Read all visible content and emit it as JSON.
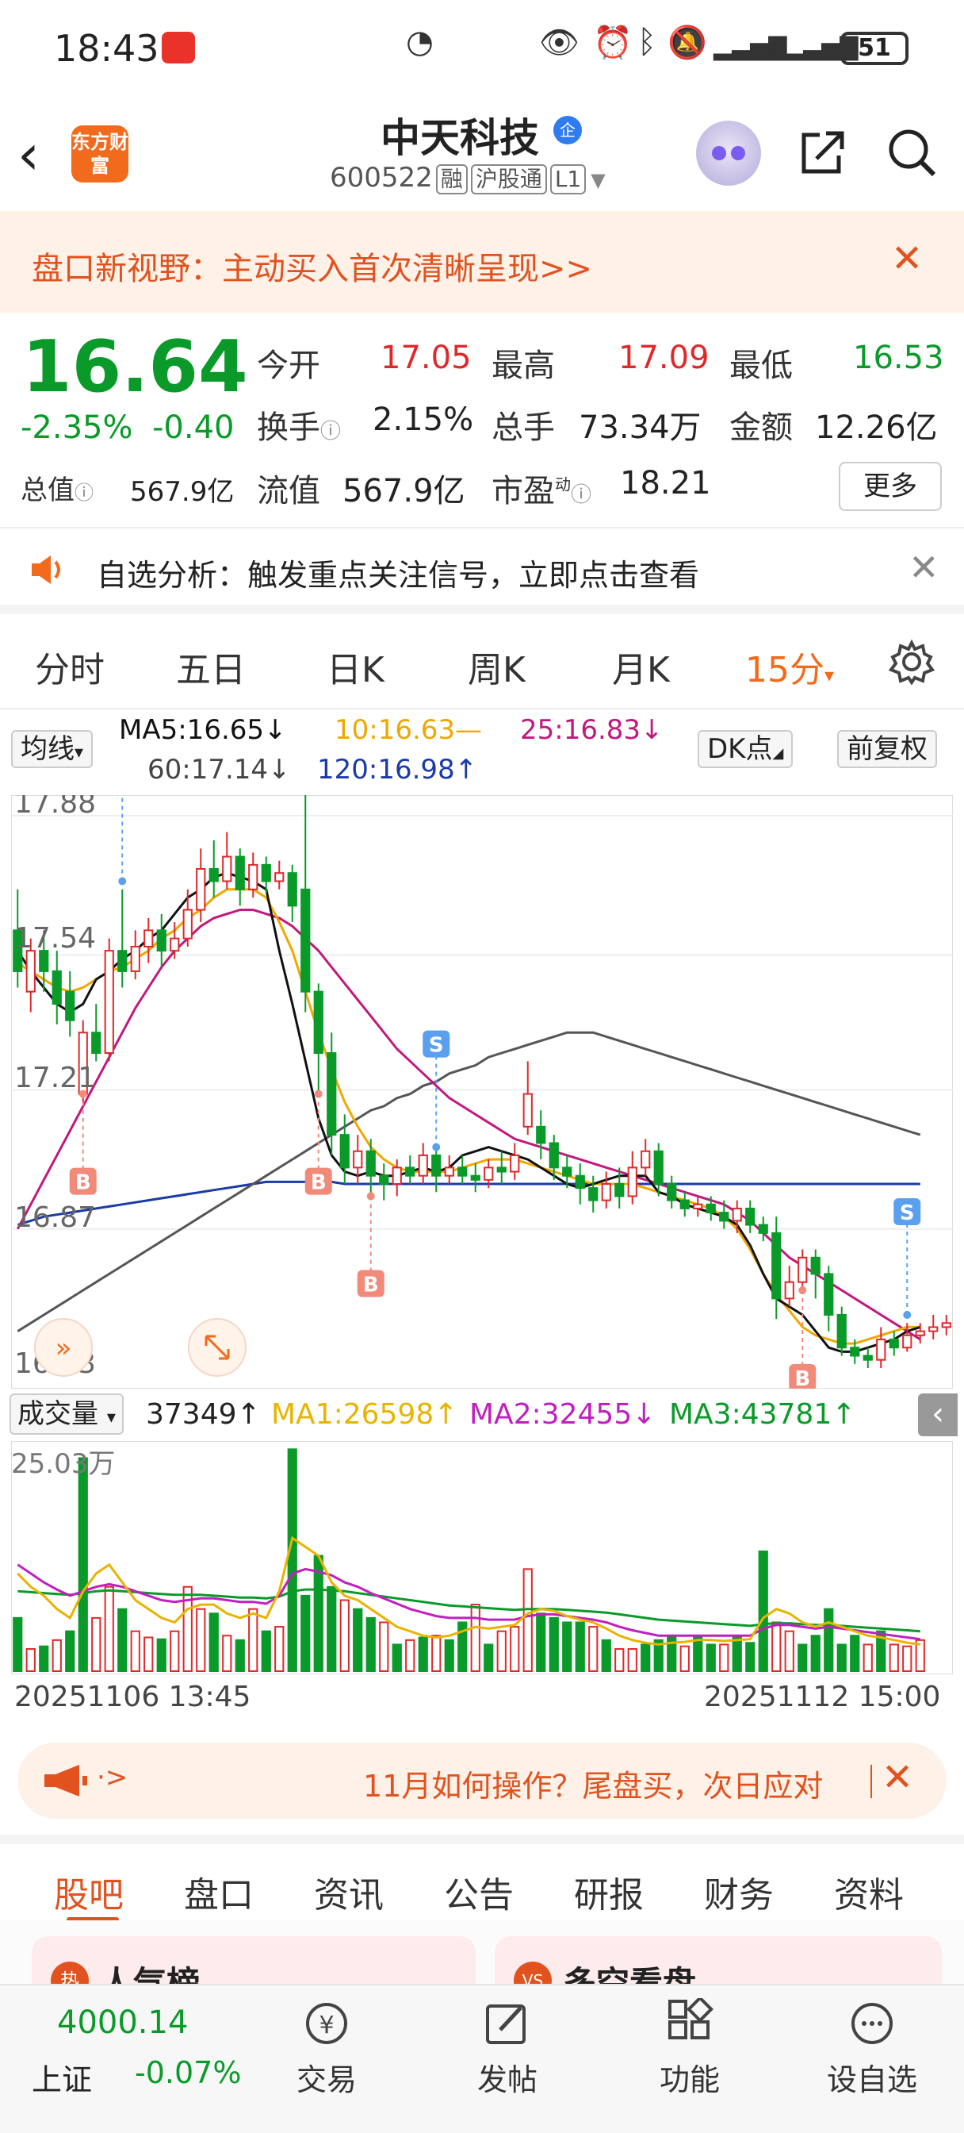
{
  "status_bar": {
    "time": "18:43",
    "battery": "51"
  },
  "header": {
    "logo": "东方财富",
    "title": "中天科技",
    "badge": "企",
    "code": "600522",
    "tags": [
      "融",
      "沪股通",
      "L1"
    ]
  },
  "banner": {
    "text": "盘口新视野：主动买入首次清晰呈现>>"
  },
  "quote": {
    "price": "16.64",
    "change_pct": "-2.35%",
    "change": "-0.40",
    "open_label": "今开",
    "open": "17.05",
    "high_label": "最高",
    "high": "17.09",
    "low_label": "最低",
    "low": "16.53",
    "turnover_label": "换手",
    "turnover": "2.15%",
    "volume_label": "总手",
    "volume": "73.34万",
    "amount_label": "金额",
    "amount": "12.26亿",
    "mktcap_label": "总值",
    "mktcap": "567.9亿",
    "float_label": "流值",
    "float": "567.9亿",
    "pe_label": "市盈",
    "pe_sup": "动",
    "pe": "18.21",
    "more": "更多"
  },
  "alert": {
    "text": "自选分析：触发重点关注信号，立即点击查看"
  },
  "chart_tabs": [
    "分时",
    "五日",
    "日K",
    "周K",
    "月K",
    "15分"
  ],
  "indicators": {
    "ma_selector": "均线",
    "ma5": "MA5:16.65↓",
    "ma10": "10:16.63—",
    "ma25": "25:16.83↓",
    "ma60": "60:17.14↓",
    "ma120": "120:16.98↑",
    "dk": "DK点",
    "adjust": "前复权"
  },
  "colors": {
    "up": "#e0282a",
    "down": "#0a9a2a",
    "accent": "#f26a1b",
    "ma5": "#111111",
    "ma10": "#f0a800",
    "ma25": "#c2187d",
    "ma60": "#555555",
    "ma120": "#1a3aa8",
    "vma1": "#e8b400",
    "vma2": "#c020c0",
    "vma3": "#0a9a2a"
  },
  "chart_data": {
    "type": "candlestick",
    "y_ticks": [
      "17.88",
      "17.54",
      "17.21",
      "16.87",
      "16.53"
    ],
    "ylim": [
      16.53,
      17.88
    ],
    "candles": [
      [
        17.6,
        17.5,
        17.7,
        17.46
      ],
      [
        17.45,
        17.55,
        17.58,
        17.4
      ],
      [
        17.55,
        17.5,
        17.6,
        17.45
      ],
      [
        17.5,
        17.42,
        17.55,
        17.37
      ],
      [
        17.45,
        17.38,
        17.5,
        17.34
      ],
      [
        17.2,
        17.35,
        17.38,
        17.18
      ],
      [
        17.35,
        17.3,
        17.42,
        17.28
      ],
      [
        17.3,
        17.55,
        17.58,
        17.28
      ],
      [
        17.55,
        17.5,
        17.7,
        17.46
      ],
      [
        17.5,
        17.56,
        17.6,
        17.48
      ],
      [
        17.56,
        17.6,
        17.63,
        17.52
      ],
      [
        17.6,
        17.55,
        17.64,
        17.51
      ],
      [
        17.55,
        17.58,
        17.62,
        17.53
      ],
      [
        17.58,
        17.65,
        17.7,
        17.56
      ],
      [
        17.65,
        17.75,
        17.8,
        17.62
      ],
      [
        17.75,
        17.72,
        17.82,
        17.68
      ],
      [
        17.72,
        17.78,
        17.84,
        17.7
      ],
      [
        17.78,
        17.7,
        17.8,
        17.66
      ],
      [
        17.7,
        17.76,
        17.79,
        17.68
      ],
      [
        17.76,
        17.72,
        17.78,
        17.69
      ],
      [
        17.72,
        17.74,
        17.77,
        17.7
      ],
      [
        17.74,
        17.66,
        17.76,
        17.62
      ],
      [
        17.7,
        17.45,
        18.05,
        17.4
      ],
      [
        17.45,
        17.3,
        17.47,
        17.2
      ],
      [
        17.3,
        17.1,
        17.35,
        17.05
      ],
      [
        17.1,
        17.02,
        17.15,
        16.98
      ],
      [
        17.02,
        17.06,
        17.1,
        16.98
      ],
      [
        17.06,
        17.0,
        17.09,
        16.95
      ],
      [
        17.0,
        16.98,
        17.03,
        16.94
      ],
      [
        16.98,
        17.02,
        17.04,
        16.95
      ],
      [
        17.02,
        17.0,
        17.05,
        16.98
      ],
      [
        17.0,
        17.05,
        17.08,
        16.98
      ],
      [
        17.05,
        17.0,
        17.07,
        16.96
      ],
      [
        17.0,
        17.02,
        17.05,
        16.98
      ],
      [
        17.02,
        17.0,
        17.05,
        16.98
      ],
      [
        17.0,
        16.99,
        17.03,
        16.96
      ],
      [
        16.99,
        17.02,
        17.04,
        16.97
      ],
      [
        17.02,
        17.01,
        17.06,
        16.98
      ],
      [
        17.01,
        17.05,
        17.08,
        16.99
      ],
      [
        17.12,
        17.2,
        17.28,
        17.1
      ],
      [
        17.12,
        17.08,
        17.16,
        17.04
      ],
      [
        17.08,
        17.02,
        17.1,
        16.99
      ],
      [
        17.02,
        17.0,
        17.05,
        16.97
      ],
      [
        17.0,
        16.97,
        17.03,
        16.93
      ],
      [
        16.97,
        16.94,
        17.0,
        16.91
      ],
      [
        16.94,
        16.98,
        17.01,
        16.92
      ],
      [
        16.98,
        16.95,
        17.02,
        16.92
      ],
      [
        16.95,
        17.02,
        17.06,
        16.93
      ],
      [
        17.02,
        17.06,
        17.09,
        17.0
      ],
      [
        17.06,
        16.98,
        17.08,
        16.95
      ],
      [
        16.98,
        16.94,
        17.0,
        16.92
      ],
      [
        16.94,
        16.92,
        16.96,
        16.9
      ],
      [
        16.92,
        16.93,
        16.95,
        16.9
      ],
      [
        16.93,
        16.91,
        16.95,
        16.89
      ],
      [
        16.91,
        16.89,
        16.94,
        16.87
      ],
      [
        16.89,
        16.92,
        16.94,
        16.86
      ],
      [
        16.92,
        16.88,
        16.94,
        16.86
      ],
      [
        16.88,
        16.86,
        16.9,
        16.84
      ],
      [
        16.86,
        16.7,
        16.9,
        16.65
      ],
      [
        16.7,
        16.74,
        16.78,
        16.68
      ],
      [
        16.74,
        16.8,
        16.82,
        16.72
      ],
      [
        16.8,
        16.76,
        16.82,
        16.7
      ],
      [
        16.76,
        16.66,
        16.78,
        16.62
      ],
      [
        16.66,
        16.58,
        16.68,
        16.56
      ],
      [
        16.58,
        16.56,
        16.6,
        16.54
      ],
      [
        16.56,
        16.55,
        16.58,
        16.53
      ],
      [
        16.55,
        16.6,
        16.63,
        16.53
      ],
      [
        16.6,
        16.58,
        16.62,
        16.56
      ],
      [
        16.58,
        16.61,
        16.64,
        16.57
      ],
      [
        16.61,
        16.62,
        16.64,
        16.59
      ],
      [
        16.62,
        16.63,
        16.66,
        16.6
      ],
      [
        16.63,
        16.64,
        16.66,
        16.61
      ]
    ],
    "ma5": [
      17.55,
      17.5,
      17.46,
      17.42,
      17.4,
      17.42,
      17.48,
      17.5,
      17.53,
      17.55,
      17.58,
      17.6,
      17.64,
      17.68,
      17.7,
      17.73,
      17.74,
      17.73,
      17.72,
      17.7,
      17.55,
      17.42,
      17.28,
      17.14,
      17.05,
      17.01,
      17.0,
      17.01,
      17.0,
      17.0,
      17.01,
      17.02,
      17.01,
      17.02,
      17.05,
      17.06,
      17.07,
      17.06,
      17.05,
      17.04,
      17.02,
      17.0,
      16.98,
      16.97,
      16.98,
      16.99,
      17.0,
      17.0,
      17.0,
      16.96,
      16.95,
      16.93,
      16.92,
      16.91,
      16.9,
      16.88,
      16.83,
      16.76,
      16.7,
      16.68,
      16.66,
      16.62,
      16.58,
      16.57,
      16.57,
      16.58,
      16.59,
      16.6,
      16.62,
      16.63
    ],
    "ma10": [
      17.52,
      17.5,
      17.48,
      17.46,
      17.45,
      17.46,
      17.48,
      17.5,
      17.51,
      17.53,
      17.55,
      17.58,
      17.6,
      17.63,
      17.65,
      17.68,
      17.7,
      17.7,
      17.7,
      17.68,
      17.62,
      17.55,
      17.45,
      17.35,
      17.26,
      17.18,
      17.12,
      17.07,
      17.04,
      17.02,
      17.01,
      17.01,
      17.01,
      17.01,
      17.02,
      17.03,
      17.04,
      17.04,
      17.04,
      17.03,
      17.02,
      17.01,
      17.0,
      16.99,
      16.98,
      16.98,
      16.98,
      16.98,
      16.97,
      16.96,
      16.95,
      16.94,
      16.93,
      16.92,
      16.9,
      16.87,
      16.82,
      16.76,
      16.71,
      16.67,
      16.63,
      16.61,
      16.6,
      16.59,
      16.59,
      16.6,
      16.61,
      16.62,
      16.63,
      16.63
    ],
    "ma25": [
      16.87,
      16.93,
      16.99,
      17.05,
      17.11,
      17.17,
      17.23,
      17.29,
      17.35,
      17.41,
      17.46,
      17.51,
      17.55,
      17.58,
      17.61,
      17.63,
      17.64,
      17.65,
      17.65,
      17.64,
      17.63,
      17.61,
      17.58,
      17.55,
      17.51,
      17.47,
      17.43,
      17.39,
      17.35,
      17.31,
      17.28,
      17.25,
      17.22,
      17.19,
      17.17,
      17.15,
      17.13,
      17.11,
      17.09,
      17.08,
      17.07,
      17.06,
      17.05,
      17.04,
      17.03,
      17.02,
      17.01,
      17.0,
      16.99,
      16.98,
      16.97,
      16.96,
      16.95,
      16.94,
      16.93,
      16.91,
      16.89,
      16.86,
      16.83,
      16.8,
      16.78,
      16.76,
      16.74,
      16.72,
      16.7,
      16.68,
      16.66,
      16.64,
      16.62,
      16.6
    ],
    "ma60": [
      16.62,
      16.64,
      16.66,
      16.68,
      16.7,
      16.72,
      16.74,
      16.76,
      16.78,
      16.8,
      16.82,
      16.84,
      16.86,
      16.88,
      16.9,
      16.92,
      16.94,
      16.96,
      16.98,
      17.0,
      17.02,
      17.04,
      17.06,
      17.08,
      17.1,
      17.12,
      17.14,
      17.16,
      17.17,
      17.19,
      17.2,
      17.22,
      17.23,
      17.25,
      17.26,
      17.27,
      17.29,
      17.3,
      17.31,
      17.32,
      17.33,
      17.34,
      17.35,
      17.35,
      17.35,
      17.34,
      17.33,
      17.32,
      17.31,
      17.3,
      17.29,
      17.28,
      17.27,
      17.26,
      17.25,
      17.24,
      17.23,
      17.22,
      17.21,
      17.2,
      17.19,
      17.18,
      17.17,
      17.16,
      17.15,
      17.14,
      17.13,
      17.12,
      17.11,
      17.1
    ],
    "ma120": [
      16.88,
      16.89,
      16.9,
      16.905,
      16.91,
      16.915,
      16.92,
      16.925,
      16.93,
      16.935,
      16.94,
      16.945,
      16.95,
      16.955,
      16.96,
      16.965,
      16.97,
      16.975,
      16.98,
      16.985,
      16.985,
      16.985,
      16.985,
      16.985,
      16.985,
      16.98,
      16.98,
      16.98,
      16.98,
      16.98,
      16.98,
      16.98,
      16.98,
      16.98,
      16.98,
      16.98,
      16.98,
      16.98,
      16.98,
      16.98,
      16.98,
      16.98,
      16.98,
      16.98,
      16.98,
      16.98,
      16.98,
      16.98,
      16.98,
      16.98,
      16.98,
      16.98,
      16.98,
      16.98,
      16.98,
      16.98,
      16.98,
      16.98,
      16.98,
      16.98,
      16.98,
      16.98,
      16.98,
      16.98,
      16.98,
      16.98,
      16.98,
      16.98,
      16.98,
      16.98
    ],
    "signals": [
      {
        "type": "B",
        "index": 5,
        "price": 17.2
      },
      {
        "type": "S",
        "index": 8,
        "price": 17.72
      },
      {
        "type": "B",
        "index": 23,
        "price": 17.2
      },
      {
        "type": "B",
        "index": 27,
        "price": 16.95
      },
      {
        "type": "S",
        "index": 32,
        "price": 17.07
      },
      {
        "type": "B",
        "index": 60,
        "price": 16.72
      },
      {
        "type": "S",
        "index": 68,
        "price": 16.66
      }
    ],
    "volume_label": "成交量",
    "volume_current": "37349↑",
    "vma1": "MA1:26598↑",
    "vma2": "MA2:32455↓",
    "vma3": "MA3:43781↑",
    "volume_max_label": "25.03万",
    "volume_max": 250300,
    "volumes": [
      60000,
      25000,
      28000,
      35000,
      45000,
      240000,
      60000,
      95000,
      70000,
      45000,
      38000,
      36000,
      45000,
      95000,
      70000,
      65000,
      40000,
      35000,
      70000,
      45000,
      50000,
      250000,
      85000,
      130000,
      95000,
      80000,
      70000,
      60000,
      55000,
      30000,
      35000,
      38000,
      40000,
      35000,
      55000,
      75000,
      30000,
      45000,
      50000,
      115000,
      65000,
      60000,
      55000,
      55000,
      50000,
      35000,
      25000,
      25000,
      30000,
      35000,
      40000,
      28000,
      40000,
      30000,
      30000,
      40000,
      32000,
      135000,
      55000,
      45000,
      30000,
      40000,
      70000,
      30000,
      40000,
      30000,
      45000,
      30000,
      28000,
      35000
    ],
    "volume_up": [
      false,
      true,
      false,
      true,
      false,
      false,
      true,
      true,
      false,
      true,
      true,
      false,
      true,
      true,
      true,
      false,
      true,
      false,
      true,
      false,
      true,
      false,
      false,
      false,
      false,
      true,
      false,
      false,
      true,
      false,
      true,
      false,
      true,
      false,
      false,
      true,
      false,
      true,
      true,
      true,
      false,
      false,
      false,
      false,
      true,
      false,
      true,
      true,
      false,
      false,
      false,
      true,
      false,
      false,
      true,
      false,
      false,
      false,
      true,
      true,
      false,
      false,
      false,
      false,
      false,
      true,
      false,
      true,
      true,
      true
    ],
    "vma1_line": [
      110000,
      95000,
      85000,
      70000,
      60000,
      90000,
      110000,
      120000,
      100000,
      80000,
      70000,
      60000,
      55000,
      70000,
      75000,
      75000,
      65000,
      60000,
      65000,
      60000,
      90000,
      150000,
      140000,
      130000,
      100000,
      85000,
      80000,
      70000,
      60000,
      50000,
      45000,
      40000,
      38000,
      40000,
      45000,
      50000,
      48000,
      50000,
      52000,
      65000,
      70000,
      68000,
      62000,
      58000,
      55000,
      48000,
      40000,
      35000,
      32000,
      30000,
      32000,
      33000,
      35000,
      35000,
      34000,
      35000,
      36000,
      60000,
      70000,
      65000,
      55000,
      50000,
      55000,
      50000,
      45000,
      40000,
      38000,
      35000,
      32000,
      30000
    ],
    "vma2_line": [
      120000,
      110000,
      100000,
      92000,
      85000,
      90000,
      95000,
      98000,
      95000,
      90000,
      85000,
      80000,
      78000,
      80000,
      82000,
      82000,
      80000,
      78000,
      78000,
      76000,
      85000,
      110000,
      115000,
      112000,
      108000,
      100000,
      95000,
      88000,
      82000,
      76000,
      70000,
      66000,
      62000,
      60000,
      60000,
      60000,
      58000,
      58000,
      58000,
      62000,
      64000,
      64000,
      62000,
      60000,
      58000,
      55000,
      50000,
      46000,
      43000,
      40000,
      40000,
      40000,
      40000,
      40000,
      40000,
      40000,
      40000,
      48000,
      52000,
      52000,
      50000,
      48000,
      50000,
      48000,
      46000,
      44000,
      42000,
      40000,
      38000,
      36000
    ],
    "vma3_line": [
      90000,
      89000,
      88000,
      87000,
      86000,
      88000,
      90000,
      91000,
      90000,
      89000,
      88000,
      87000,
      86000,
      86000,
      86000,
      85000,
      84000,
      83000,
      83000,
      82000,
      84000,
      90000,
      92000,
      92000,
      91000,
      90000,
      88000,
      86000,
      84000,
      82000,
      80000,
      78000,
      76000,
      74000,
      73000,
      72000,
      71000,
      70000,
      69000,
      70000,
      70000,
      70000,
      69000,
      68000,
      67000,
      66000,
      64000,
      62000,
      60000,
      58000,
      57000,
      56000,
      55000,
      54000,
      53000,
      52000,
      51000,
      53000,
      54000,
      54000,
      53000,
      52000,
      52000,
      51000,
      50000,
      49000,
      48000,
      47000,
      46000,
      45000
    ],
    "date_start": "20251106 13:45",
    "date_end": "20251112 15:00"
  },
  "promo": {
    "text": "11月如何操作？尾盘买，次日应对"
  },
  "bottom_tabs": [
    "股吧",
    "盘口",
    "资讯",
    "公告",
    "研报",
    "财务",
    "资料"
  ],
  "peek": {
    "left": "人气榜",
    "left_icon": "热",
    "right": "多空看盘",
    "right_icon": "VS"
  },
  "bottom_bar": {
    "index_value": "4000.14",
    "index_name": "上证",
    "index_change": "-0.07%",
    "items": [
      "交易",
      "发帖",
      "功能",
      "设自选"
    ]
  }
}
